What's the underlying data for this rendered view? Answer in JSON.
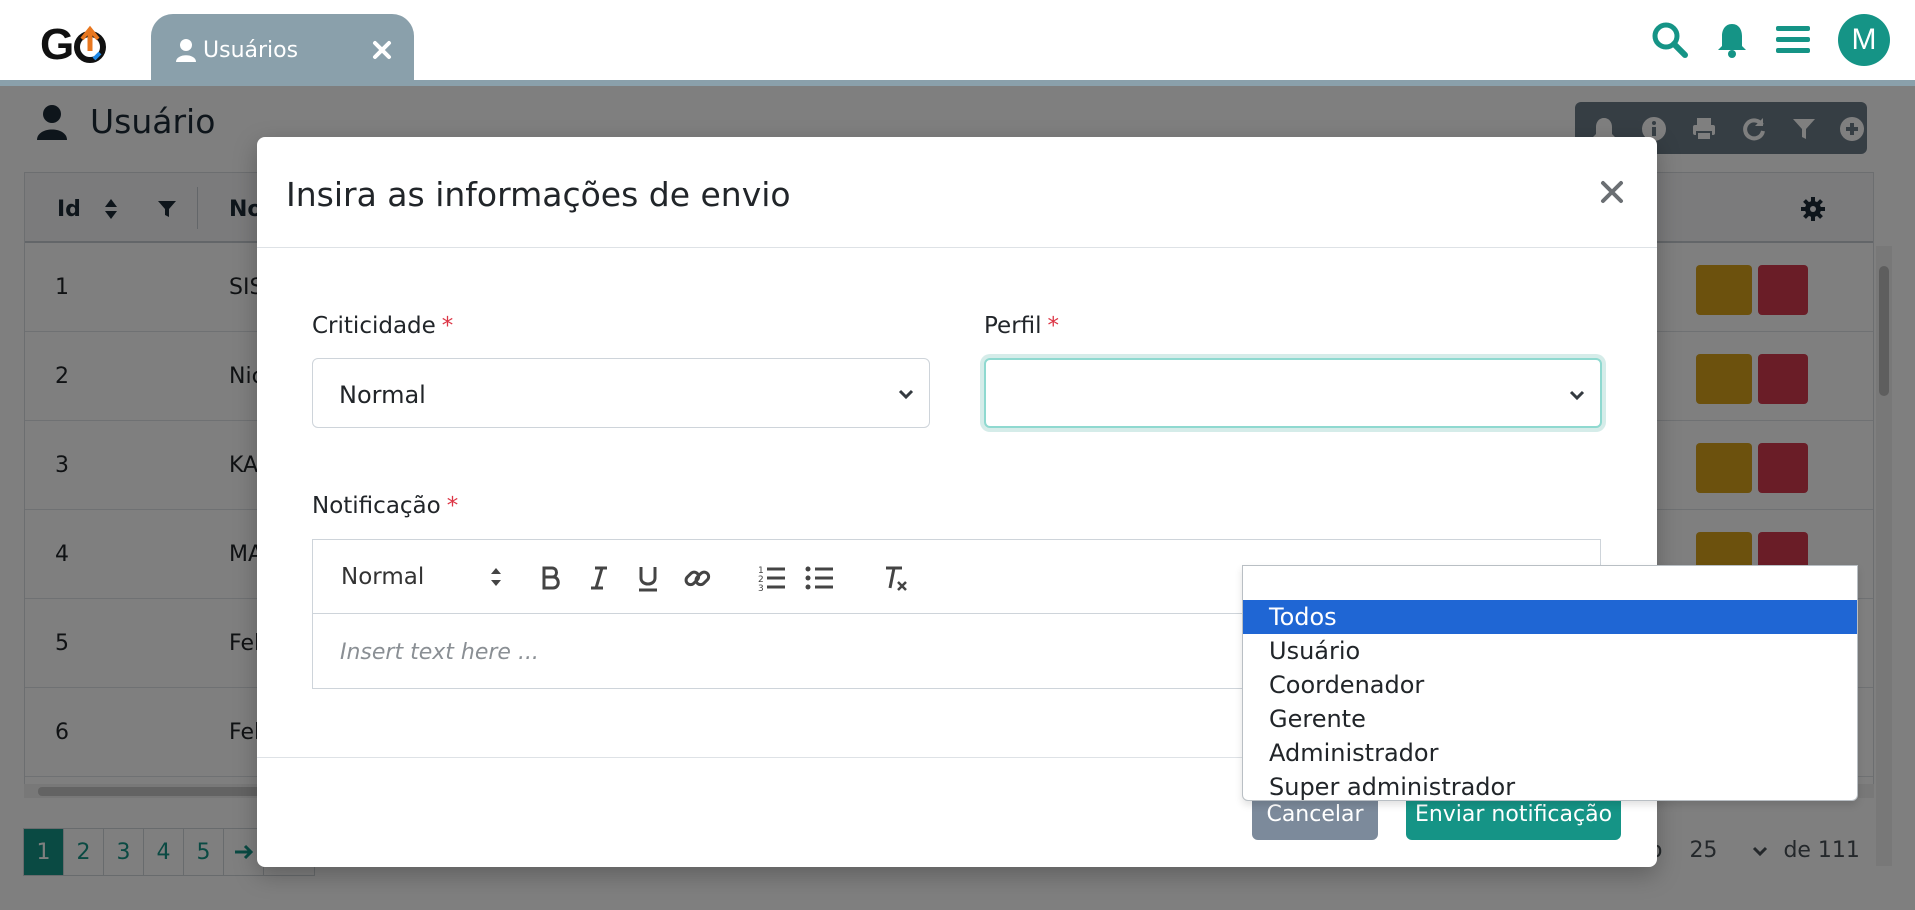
{
  "app": {
    "logo_text": "GO",
    "tab": {
      "label": "Usuários"
    }
  },
  "header_icons": [
    "search-icon",
    "bell-icon",
    "menu-icon"
  ],
  "user": {
    "avatar_letter": "M"
  },
  "page": {
    "title": "Usuário",
    "toolbar_icons": [
      "bell-icon",
      "info-icon",
      "print-icon",
      "refresh-icon",
      "filter-icon",
      "plus-circle-icon"
    ],
    "grid": {
      "columns": [
        "Id",
        "No"
      ],
      "rows": [
        {
          "id": "1",
          "name": "SIS"
        },
        {
          "id": "2",
          "name": "Nic"
        },
        {
          "id": "3",
          "name": "KA"
        },
        {
          "id": "4",
          "name": "MA"
        },
        {
          "id": "5",
          "name": "Fel"
        },
        {
          "id": "6",
          "name": "Fel"
        }
      ]
    },
    "pagination": {
      "pages": [
        "1",
        "2",
        "3",
        "4",
        "5"
      ],
      "current": "1"
    },
    "page_size": {
      "label_suffix": "do",
      "value": "25",
      "total": "de 111"
    }
  },
  "modal": {
    "title": "Insira as informações de envio",
    "criticidade": {
      "label": "Criticidade",
      "required_mark": "*",
      "value": "Normal"
    },
    "perfil": {
      "label": "Perfil",
      "required_mark": "*",
      "value": "",
      "options": [
        "",
        "Todos",
        "Usuário",
        "Coordenador",
        "Gerente",
        "Administrador",
        "Super administrador"
      ],
      "highlighted": "Todos"
    },
    "notificacao": {
      "label": "Notificação",
      "required_mark": "*",
      "format": "Normal",
      "placeholder": "Insert text here ..."
    },
    "buttons": {
      "cancel": "Cancelar",
      "send": "Enviar notificação"
    }
  },
  "colors": {
    "brand": "#159486",
    "tab_bg": "#8aa0ab",
    "edit": "#d8a21a",
    "delete": "#d43a4e",
    "option_highlight": "#1f66d4",
    "cancel": "#7c8a9b"
  }
}
